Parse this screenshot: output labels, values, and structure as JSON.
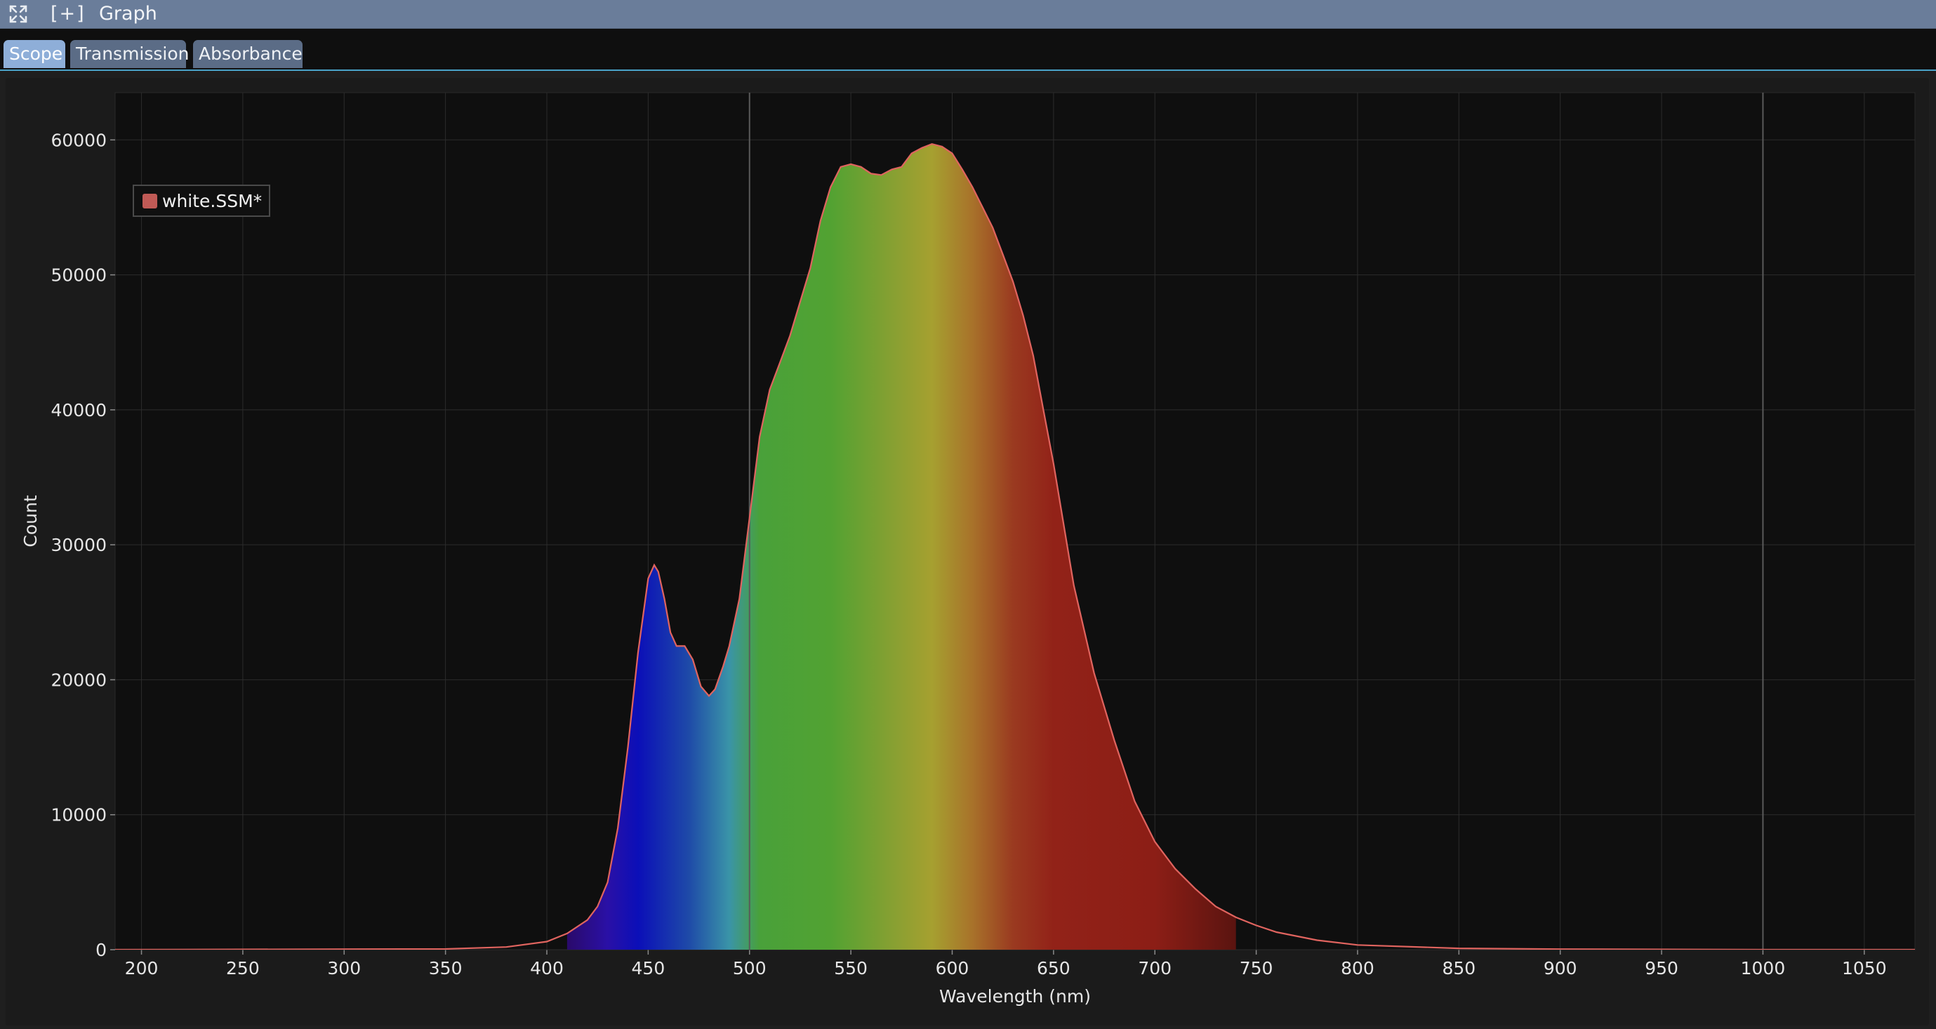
{
  "window": {
    "title": "Graph",
    "add_label": "[+]",
    "expand_icon": "expand-icon"
  },
  "tabs": [
    {
      "label": "Scope",
      "active": true
    },
    {
      "label": "Transmission",
      "active": false
    },
    {
      "label": "Absorbance",
      "active": false
    }
  ],
  "colors": {
    "series_line": "#e0645f",
    "legend_swatch": "#c05a56",
    "plot_background": "#0f0f0f",
    "grid": "#2c2c2c",
    "marker_line": "#5a5a5a"
  },
  "chart_data": {
    "type": "area",
    "xlabel": "Wavelength (nm)",
    "ylabel": "Count",
    "xlim": [
      187,
      1075
    ],
    "ylim": [
      0,
      63500
    ],
    "x_ticks": [
      200,
      250,
      300,
      350,
      400,
      450,
      500,
      550,
      600,
      650,
      700,
      750,
      800,
      850,
      900,
      950,
      1000,
      1050
    ],
    "y_ticks": [
      0,
      10000,
      20000,
      30000,
      40000,
      50000,
      60000
    ],
    "grid": true,
    "legend_position": "top-left",
    "spectrum_fill_range": [
      410,
      740
    ],
    "marker_lines": [
      500,
      1000
    ],
    "series": [
      {
        "name": "white.SSM*",
        "x": [
          187,
          350,
          380,
          400,
          410,
          420,
          425,
          430,
          435,
          440,
          445,
          450,
          453,
          455,
          458,
          461,
          464,
          468,
          472,
          476,
          480,
          483,
          487,
          490,
          495,
          500,
          505,
          510,
          515,
          520,
          525,
          530,
          535,
          540,
          545,
          550,
          555,
          560,
          565,
          570,
          575,
          580,
          585,
          590,
          595,
          600,
          605,
          610,
          615,
          620,
          625,
          630,
          635,
          640,
          645,
          650,
          660,
          670,
          680,
          690,
          700,
          710,
          720,
          730,
          740,
          750,
          760,
          780,
          800,
          850,
          900,
          1000,
          1075
        ],
        "y": [
          0,
          50,
          200,
          600,
          1200,
          2200,
          3200,
          5000,
          9000,
          15000,
          22000,
          27500,
          28500,
          28000,
          26000,
          23500,
          22500,
          22500,
          21500,
          19500,
          18800,
          19300,
          21000,
          22500,
          26000,
          32000,
          38000,
          41500,
          43500,
          45500,
          48000,
          50500,
          54000,
          56500,
          58000,
          58200,
          58000,
          57500,
          57400,
          57800,
          58000,
          59000,
          59400,
          59700,
          59500,
          59000,
          57800,
          56500,
          55000,
          53500,
          51500,
          49500,
          47000,
          44000,
          40000,
          36000,
          27000,
          20500,
          15500,
          11000,
          8000,
          6000,
          4500,
          3200,
          2400,
          1800,
          1300,
          700,
          350,
          100,
          40,
          0,
          0
        ]
      }
    ]
  }
}
